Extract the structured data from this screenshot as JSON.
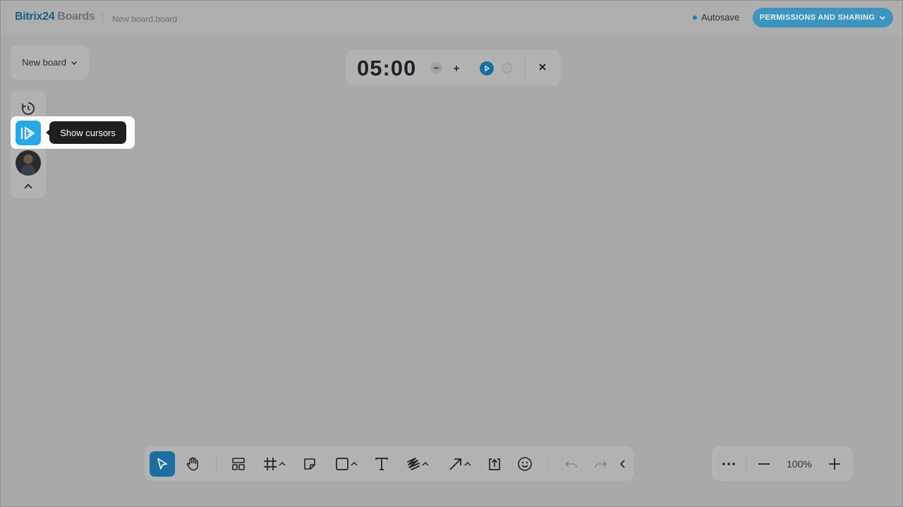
{
  "header": {
    "logo_brand": "Bitrix24",
    "logo_product": "Boards",
    "file_name": "New board.board",
    "autosave_label": "Autosave",
    "permissions_label": "PERMISSIONS AND SHARING"
  },
  "board_selector": {
    "label": "New board"
  },
  "timer": {
    "value": "05:00"
  },
  "sidebar": {
    "tooltip": "Show cursors"
  },
  "zoom": {
    "level": "100%"
  },
  "colors": {
    "accent": "#29a8e8",
    "primary_dark": "#1b6e9e",
    "canvas_overlay": "#a9a9a9"
  },
  "toolbar_icons": [
    "select-icon",
    "hand-icon",
    "layout-icon",
    "frame-icon",
    "sticky-note-icon",
    "shape-icon",
    "text-icon",
    "pen-icon",
    "arrow-icon",
    "upload-icon",
    "emoji-icon",
    "undo-icon",
    "redo-icon",
    "collapse-icon"
  ]
}
